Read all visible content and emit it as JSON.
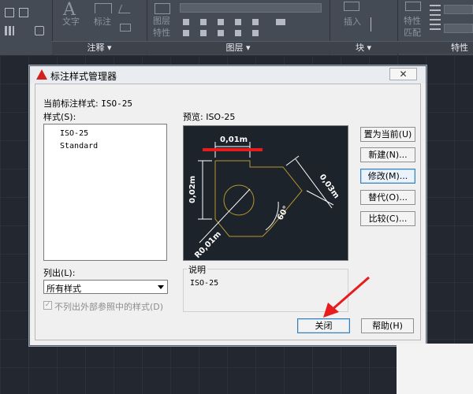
{
  "ribbon": {
    "annotation_group": {
      "text_tool": "文字",
      "dim_tool": "标注",
      "panel_title": "注释"
    },
    "layers_group": {
      "layer_props": "图层特性",
      "panel_title": "图层"
    },
    "block_group": {
      "insert": "插入",
      "panel_title": "块"
    },
    "properties_group": {
      "match": "特性匹配",
      "panel_title": "特性"
    }
  },
  "dialog": {
    "title": "标注样式管理器",
    "current_style_label": "当前标注样式:",
    "current_style_value": "ISO-25",
    "styles_label": "样式(S):",
    "styles": [
      "ISO-25",
      "Standard"
    ],
    "list_label": "列出(L):",
    "list_value": "所有样式",
    "xref_checkbox_label": "不列出外部参照中的样式(D)",
    "xref_checked": true,
    "preview_label": "预览: ISO-25",
    "description_label": "说明",
    "description_value": "ISO-25",
    "preview_dims": {
      "top": "0,01m",
      "left": "0,02m",
      "right": "0,03m",
      "angle": "60°",
      "radius": "R0,01m"
    },
    "buttons": {
      "set_current": "置为当前(U)",
      "new": "新建(N)...",
      "modify": "修改(M)...",
      "override": "替代(O)...",
      "compare": "比较(C)...",
      "close": "关闭",
      "help": "帮助(H)"
    }
  },
  "colors": {
    "annotation_red": "#e81c1c",
    "title_icon_red": "#d32020",
    "preview_bg": "#1d232b",
    "preview_geometry": "#b8962e"
  }
}
